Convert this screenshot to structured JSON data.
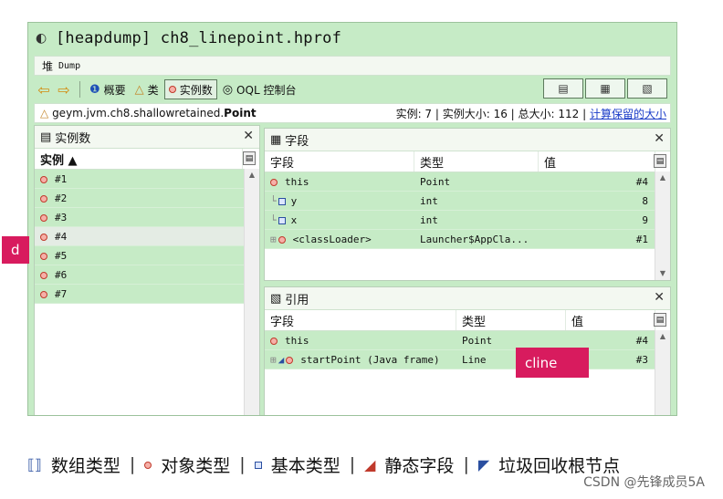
{
  "window": {
    "title": "[heapdump] ch8_linepoint.hprof",
    "subtitle": "堆",
    "subtitle_mono": "Dump"
  },
  "toolbar": {
    "items": [
      {
        "label": "概要",
        "icon": "info-icon"
      },
      {
        "label": "类",
        "icon": "classes-icon"
      },
      {
        "label": "实例数",
        "icon": "instance-icon",
        "active": true
      },
      {
        "label": "OQL 控制台",
        "icon": "oql-icon"
      }
    ]
  },
  "classbar": {
    "package": "geym.jvm.ch8.shallowretained.",
    "classname": "Point",
    "stats": "实例: 7 | 实例大小: 16 | 总大小: 112 | ",
    "link": "计算保留的大小"
  },
  "instances_panel": {
    "title": "实例数",
    "column": "实例 ▲",
    "rows": [
      "#1",
      "#2",
      "#3",
      "#4",
      "#5",
      "#6",
      "#7"
    ]
  },
  "fields_panel": {
    "title": "字段",
    "columns": [
      "字段",
      "类型",
      "值"
    ],
    "rows": [
      {
        "name": "this",
        "type": "Point",
        "value": "#4"
      },
      {
        "name": "y",
        "type": "int",
        "value": "8"
      },
      {
        "name": "x",
        "type": "int",
        "value": "9"
      },
      {
        "name": "<classLoader>",
        "type": "Launcher$AppCla...",
        "value": "#1"
      }
    ]
  },
  "refs_panel": {
    "title": "引用",
    "columns": [
      "字段",
      "类型",
      "值"
    ],
    "rows": [
      {
        "name": "this",
        "type": "Point",
        "value": "#4"
      },
      {
        "name": "startPoint (Java frame)",
        "type": "Line",
        "value": "#3"
      }
    ]
  },
  "tags": {
    "d": "d",
    "cline": "cline"
  },
  "legend": [
    {
      "label": "数组类型",
      "icon": "array-icon"
    },
    {
      "label": "对象类型",
      "icon": "object-icon"
    },
    {
      "label": "基本类型",
      "icon": "primitive-icon"
    },
    {
      "label": "静态字段",
      "icon": "static-field-icon"
    },
    {
      "label": "垃圾回收根节点",
      "icon": "gc-root-icon"
    }
  ],
  "watermark": "CSDN @先锋成员5A",
  "colors": {
    "window_bg": "#c6ebc6",
    "tag_bg": "#d81b5e",
    "link": "#1a3cc8"
  }
}
